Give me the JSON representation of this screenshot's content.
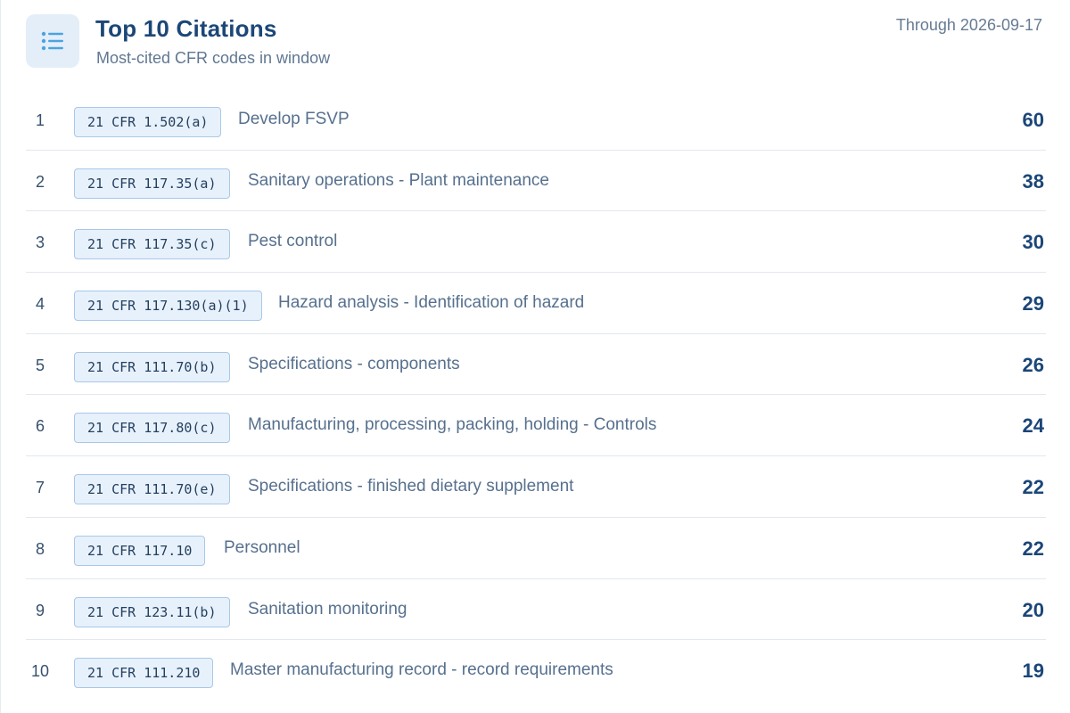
{
  "header": {
    "icon": "list-icon",
    "title": "Top 10 Citations",
    "subtitle": "Most-cited CFR codes in window",
    "through": "Through 2026-09-17"
  },
  "citations": [
    {
      "rank": "1",
      "code": "21 CFR 1.502(a)",
      "description": "Develop FSVP",
      "count": "60"
    },
    {
      "rank": "2",
      "code": "21 CFR 117.35(a)",
      "description": "Sanitary operations - Plant maintenance",
      "count": "38"
    },
    {
      "rank": "3",
      "code": "21 CFR 117.35(c)",
      "description": "Pest control",
      "count": "30"
    },
    {
      "rank": "4",
      "code": "21 CFR 117.130(a)(1)",
      "description": "Hazard analysis - Identification of hazard",
      "count": "29"
    },
    {
      "rank": "5",
      "code": "21 CFR 111.70(b)",
      "description": "Specifications - components",
      "count": "26"
    },
    {
      "rank": "6",
      "code": "21 CFR 117.80(c)",
      "description": "Manufacturing, processing, packing, holding - Controls",
      "count": "24"
    },
    {
      "rank": "7",
      "code": "21 CFR 111.70(e)",
      "description": "Specifications - finished dietary supplement",
      "count": "22"
    },
    {
      "rank": "8",
      "code": "21 CFR 117.10",
      "description": "Personnel",
      "count": "22"
    },
    {
      "rank": "9",
      "code": "21 CFR 123.11(b)",
      "description": "Sanitation monitoring",
      "count": "20"
    },
    {
      "rank": "10",
      "code": "21 CFR 111.210",
      "description": "Master manufacturing record - record requirements",
      "count": "19"
    }
  ],
  "colors": {
    "accent": "#1c4777",
    "badge_bg": "#e7f1fb",
    "badge_border": "#a9c8e8",
    "icon_bg": "#e4eef9",
    "icon_fg": "#4aa3e0"
  }
}
